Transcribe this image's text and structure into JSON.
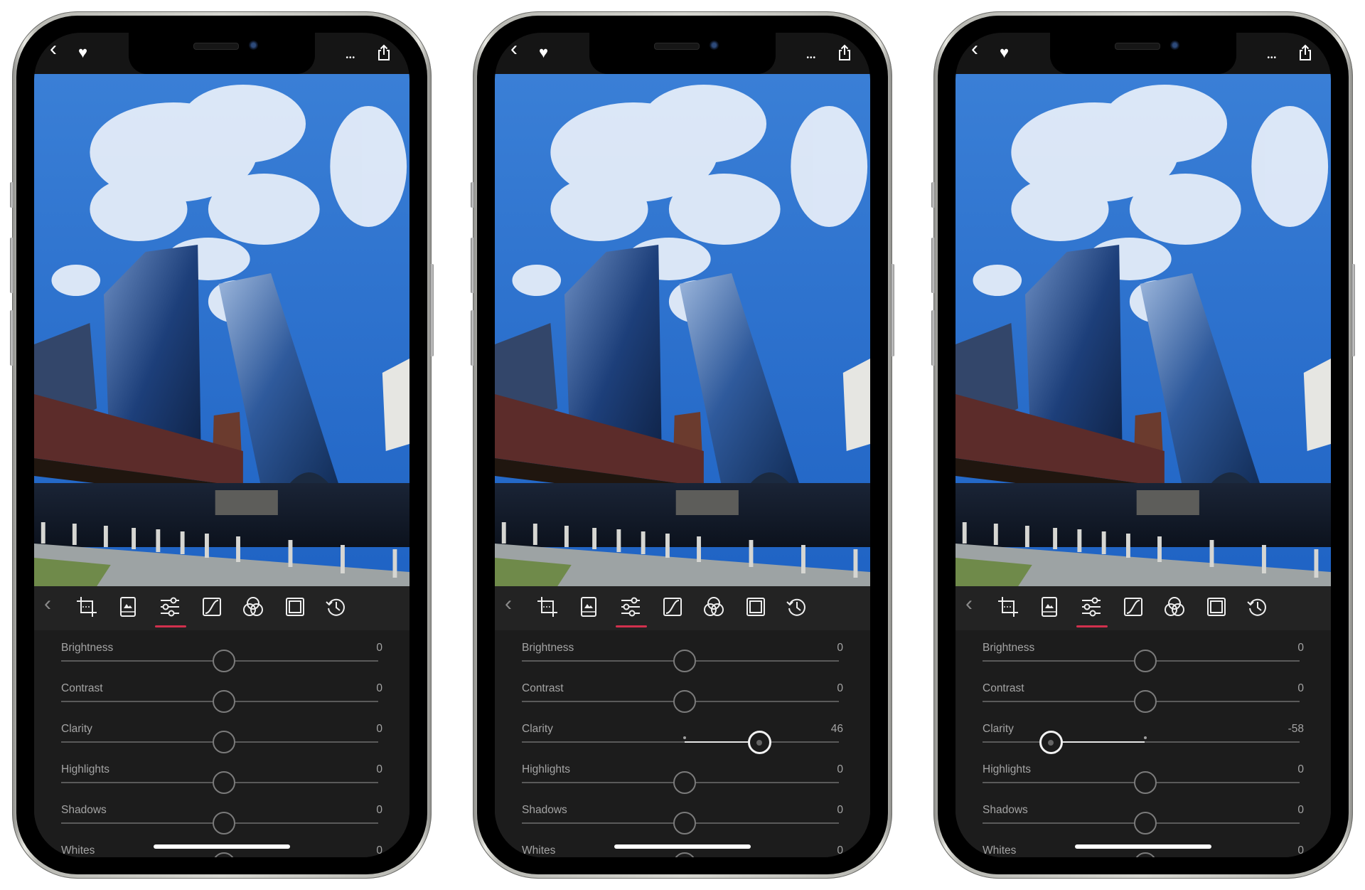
{
  "colors": {
    "accent_underline": "#d2304d",
    "panel_bg": "#1c1c1c",
    "toolbar_bg": "#232323",
    "label_text": "#a4a4a4",
    "sky": "#2f74d0"
  },
  "status_bar": {
    "left_icons": [
      "back-chevron-icon",
      "heart-icon"
    ],
    "right_icons": [
      "more-ellipsis-icon",
      "share-icon"
    ],
    "back_glyph": "‹",
    "heart_glyph": "♥",
    "more_glyph": "•••"
  },
  "toolbar": {
    "collapse_glyph": "‹",
    "tools": [
      {
        "name": "crop",
        "icon": "crop-icon"
      },
      {
        "name": "image",
        "icon": "image-frame-icon"
      },
      {
        "name": "adjust",
        "icon": "sliders-icon",
        "active": true
      },
      {
        "name": "curves",
        "icon": "curve-icon"
      },
      {
        "name": "color",
        "icon": "color-circles-icon"
      },
      {
        "name": "vignette",
        "icon": "vignette-frame-icon"
      },
      {
        "name": "history",
        "icon": "history-icon"
      }
    ]
  },
  "phones": [
    {
      "adjustments": [
        {
          "label": "Brightness",
          "value": "0",
          "level": 0
        },
        {
          "label": "Contrast",
          "value": "0",
          "level": 0
        },
        {
          "label": "Clarity",
          "value": "0",
          "level": 0
        },
        {
          "label": "Highlights",
          "value": "0",
          "level": 0
        },
        {
          "label": "Shadows",
          "value": "0",
          "level": 0
        },
        {
          "label": "Whites",
          "value": "0",
          "level": 0
        }
      ]
    },
    {
      "adjustments": [
        {
          "label": "Brightness",
          "value": "0",
          "level": 0
        },
        {
          "label": "Contrast",
          "value": "0",
          "level": 0
        },
        {
          "label": "Clarity",
          "value": "46",
          "level": 46,
          "active": true
        },
        {
          "label": "Highlights",
          "value": "0",
          "level": 0
        },
        {
          "label": "Shadows",
          "value": "0",
          "level": 0
        },
        {
          "label": "Whites",
          "value": "0",
          "level": 0
        }
      ]
    },
    {
      "adjustments": [
        {
          "label": "Brightness",
          "value": "0",
          "level": 0
        },
        {
          "label": "Contrast",
          "value": "0",
          "level": 0
        },
        {
          "label": "Clarity",
          "value": "-58",
          "level": -58,
          "active": true
        },
        {
          "label": "Highlights",
          "value": "0",
          "level": 0
        },
        {
          "label": "Shadows",
          "value": "0",
          "level": 0
        },
        {
          "label": "Whites",
          "value": "0",
          "level": 0
        }
      ]
    }
  ],
  "slider_range": [
    -100,
    100
  ]
}
